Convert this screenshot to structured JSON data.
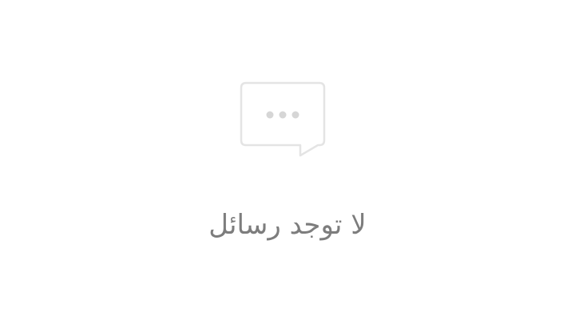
{
  "empty_state": {
    "icon": "chat-bubble-icon",
    "message": "لا توجد رسائل"
  },
  "colors": {
    "background": "#ffffff",
    "icon_stroke": "#e4e4e4",
    "icon_dots": "#d6d6d6",
    "text": "#7d7d7d"
  }
}
